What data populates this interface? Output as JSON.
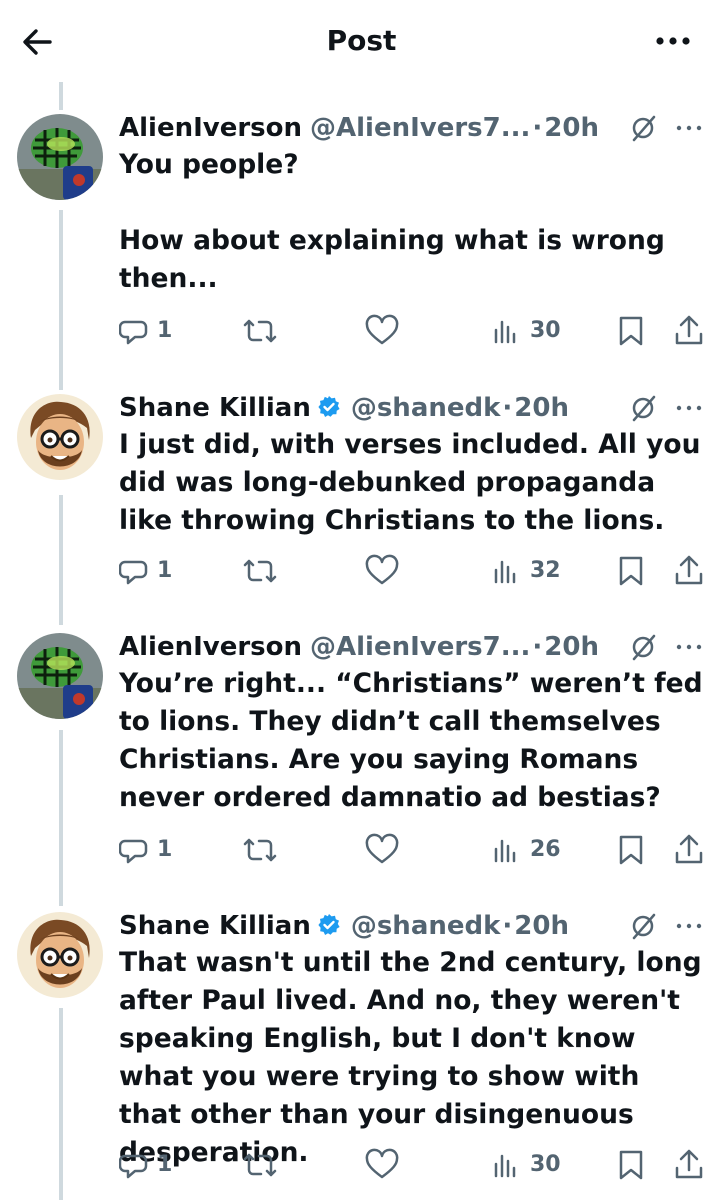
{
  "header": {
    "title": "Post",
    "back_icon": "arrow-left-icon",
    "more_icon": "more-horizontal-icon"
  },
  "colors": {
    "text": "#0f1419",
    "secondary": "#536471",
    "verified": "#1d9bf0",
    "thread_line": "#cfd9de"
  },
  "posts": [
    {
      "author": "AlienIverson",
      "handle": "@AlienIvers7...",
      "time": "20h",
      "verified": false,
      "text": "You people?\n\nHow about explaining what is wrong then...",
      "replies": "1",
      "views": "30"
    },
    {
      "author": "Shane Killian",
      "handle": "@shanedk",
      "time": "20h",
      "verified": true,
      "text": "I just did, with verses included. All you did was long-debunked propaganda like throwing Christians to the lions.",
      "replies": "1",
      "views": "32"
    },
    {
      "author": "AlienIverson",
      "handle": "@AlienIvers7...",
      "time": "20h",
      "verified": false,
      "text": "You’re right... “Christians” weren’t fed to lions. They didn’t call themselves Christians. Are you saying Romans never ordered damnatio ad bestias?",
      "replies": "1",
      "views": "26"
    },
    {
      "author": "Shane Killian",
      "handle": "@shanedk",
      "time": "20h",
      "verified": true,
      "text": "That wasn't until the 2nd century, long after Paul lived. And no, they weren't speaking English, but I don't know what you were trying to show with that other than your disingenuous desperation.",
      "replies": "1",
      "views": "30"
    }
  ]
}
